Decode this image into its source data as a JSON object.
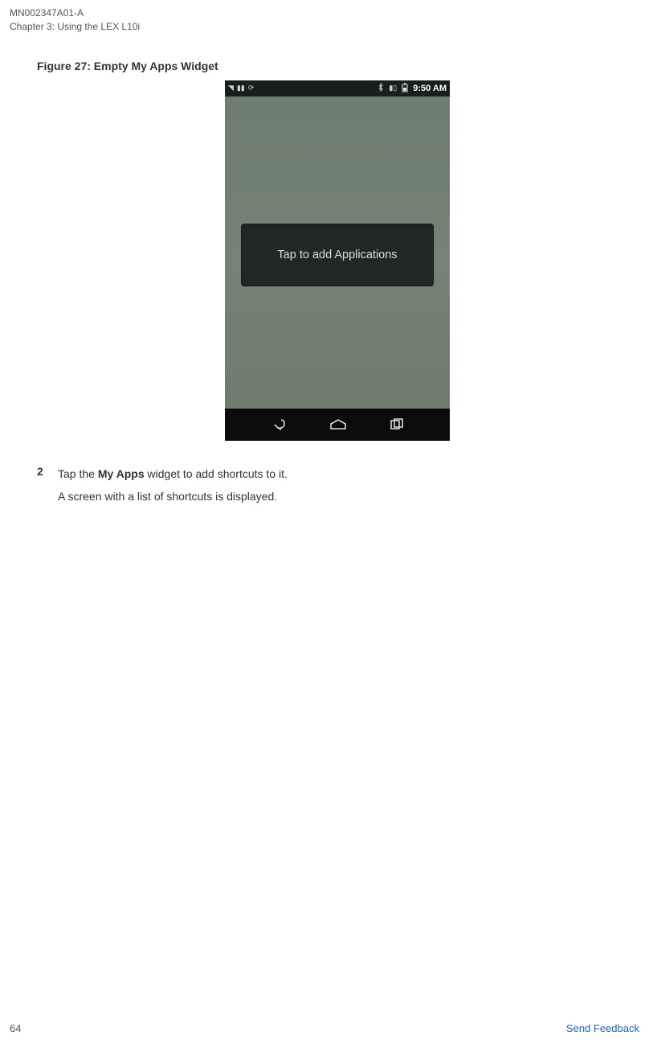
{
  "header": {
    "doc_id": "MN002347A01-A",
    "chapter": "Chapter 3:  Using the LEX L10i"
  },
  "figure": {
    "title": "Figure 27: Empty My Apps Widget"
  },
  "screenshot": {
    "statusbar": {
      "time": "9:50 AM"
    },
    "widget": {
      "text": "Tap to add Applications"
    }
  },
  "step": {
    "number": "2",
    "line1_pre": "Tap the ",
    "line1_bold": "My Apps",
    "line1_post": " widget to add shortcuts to it.",
    "line2": "A screen with a list of shortcuts is displayed."
  },
  "footer": {
    "page": "64",
    "feedback": "Send Feedback"
  }
}
